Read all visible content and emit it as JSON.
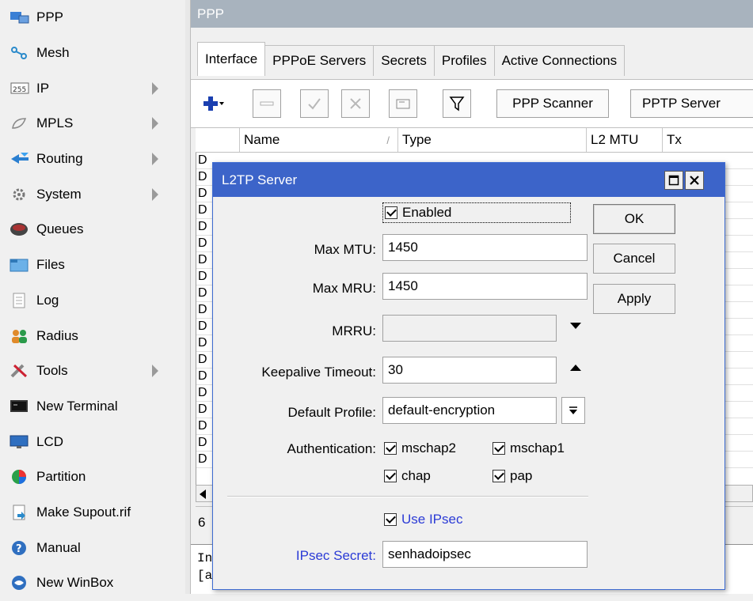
{
  "sidebar": {
    "items": [
      {
        "label": "PPP",
        "icon": "ppp-icon",
        "arrow": false
      },
      {
        "label": "Mesh",
        "icon": "mesh-icon",
        "arrow": false
      },
      {
        "label": "IP",
        "icon": "ip-icon",
        "arrow": true,
        "badge": "255"
      },
      {
        "label": "MPLS",
        "icon": "mpls-icon",
        "arrow": true
      },
      {
        "label": "Routing",
        "icon": "routing-icon",
        "arrow": true
      },
      {
        "label": "System",
        "icon": "system-icon",
        "arrow": true
      },
      {
        "label": "Queues",
        "icon": "queues-icon",
        "arrow": false
      },
      {
        "label": "Files",
        "icon": "files-icon",
        "arrow": false
      },
      {
        "label": "Log",
        "icon": "log-icon",
        "arrow": false
      },
      {
        "label": "Radius",
        "icon": "radius-icon",
        "arrow": false
      },
      {
        "label": "Tools",
        "icon": "tools-icon",
        "arrow": true
      },
      {
        "label": "New Terminal",
        "icon": "terminal-icon",
        "arrow": false
      },
      {
        "label": "LCD",
        "icon": "lcd-icon",
        "arrow": false
      },
      {
        "label": "Partition",
        "icon": "partition-icon",
        "arrow": false
      },
      {
        "label": "Make Supout.rif",
        "icon": "supout-icon",
        "arrow": false
      },
      {
        "label": "Manual",
        "icon": "manual-icon",
        "arrow": false
      },
      {
        "label": "New WinBox",
        "icon": "winbox-icon",
        "arrow": false
      }
    ]
  },
  "ppp_window": {
    "title": "PPP",
    "tabs": [
      "Interface",
      "PPPoE Servers",
      "Secrets",
      "Profiles",
      "Active Connections"
    ],
    "toolbar": {
      "scanner_label": "PPP Scanner",
      "pptp_label": "PPTP Server"
    },
    "columns": [
      "Name",
      "Type",
      "L2 MTU",
      "Tx"
    ],
    "sort_glyph": "/",
    "row_prefix": "D",
    "row_count": 19,
    "status_text": "6",
    "terminal_lines": [
      "[a",
      "In"
    ]
  },
  "dialog": {
    "title": "L2TP Server",
    "enabled_label": "Enabled",
    "fields": {
      "max_mtu_label": "Max MTU:",
      "max_mtu_value": "1450",
      "max_mru_label": "Max MRU:",
      "max_mru_value": "1450",
      "mrru_label": "MRRU:",
      "mrru_value": "",
      "keepalive_label": "Keepalive Timeout:",
      "keepalive_value": "30",
      "default_profile_label": "Default Profile:",
      "default_profile_value": "default-encryption",
      "authentication_label": "Authentication:",
      "auth_options": [
        "mschap2",
        "mschap1",
        "chap",
        "pap"
      ],
      "use_ipsec_label": "Use IPsec",
      "ipsec_secret_label": "IPsec Secret:",
      "ipsec_secret_value": "senhadoipsec"
    },
    "buttons": {
      "ok": "OK",
      "cancel": "Cancel",
      "apply": "Apply"
    }
  },
  "colors": {
    "dialog_title_bg": "#3c64c9",
    "ipsec_text": "#2b3bd6",
    "ppp_title_bg": "#a8b3be",
    "add_button_blue": "#1a3fb0"
  }
}
